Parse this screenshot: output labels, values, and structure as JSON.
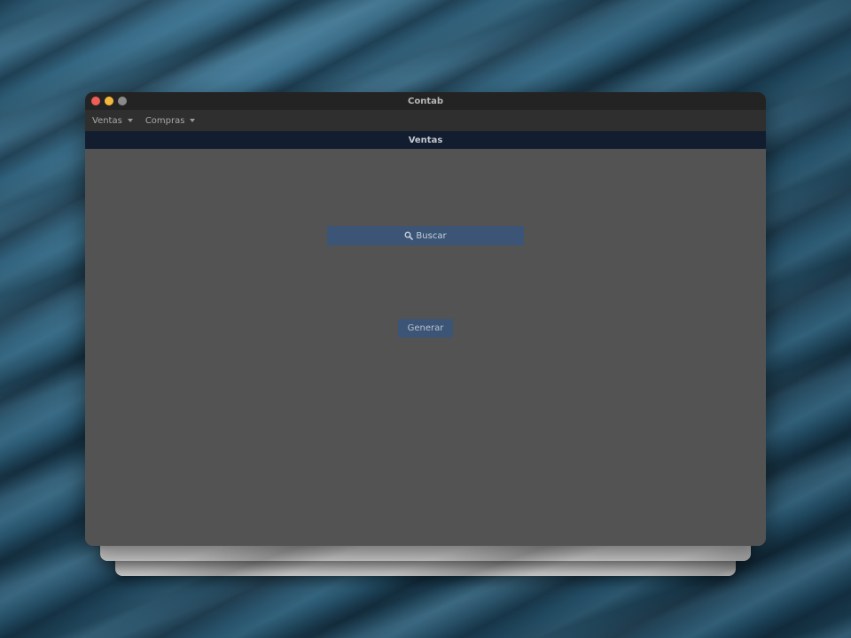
{
  "window": {
    "title": "Contab"
  },
  "menubar": {
    "items": [
      {
        "label": "Ventas",
        "icon": "chevron-down-icon"
      },
      {
        "label": "Compras",
        "icon": "chevron-down-icon"
      }
    ]
  },
  "panel": {
    "header": "Ventas"
  },
  "actions": {
    "search_label": "Buscar",
    "search_icon": "search-icon",
    "generate_label": "Generar"
  },
  "colors": {
    "accent_button": "#3c5576",
    "panel_header_bg": "#121d30",
    "window_bg": "#535353"
  }
}
